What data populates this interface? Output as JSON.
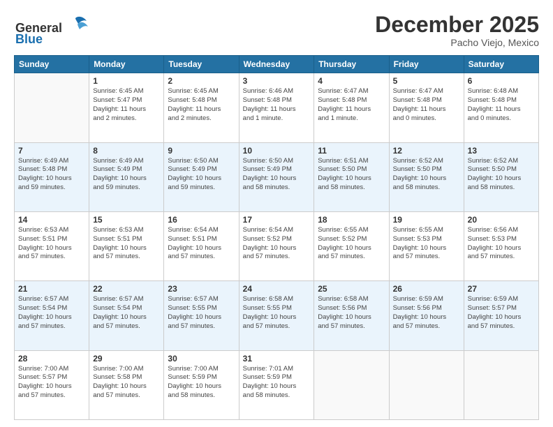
{
  "header": {
    "logo": {
      "text_general": "General",
      "text_blue": "Blue"
    },
    "title": "December 2025",
    "location": "Pacho Viejo, Mexico"
  },
  "calendar": {
    "columns": [
      "Sunday",
      "Monday",
      "Tuesday",
      "Wednesday",
      "Thursday",
      "Friday",
      "Saturday"
    ],
    "weeks": [
      {
        "days": [
          {
            "num": "",
            "info": ""
          },
          {
            "num": "1",
            "info": "Sunrise: 6:45 AM\nSunset: 5:47 PM\nDaylight: 11 hours\nand 2 minutes."
          },
          {
            "num": "2",
            "info": "Sunrise: 6:45 AM\nSunset: 5:48 PM\nDaylight: 11 hours\nand 2 minutes."
          },
          {
            "num": "3",
            "info": "Sunrise: 6:46 AM\nSunset: 5:48 PM\nDaylight: 11 hours\nand 1 minute."
          },
          {
            "num": "4",
            "info": "Sunrise: 6:47 AM\nSunset: 5:48 PM\nDaylight: 11 hours\nand 1 minute."
          },
          {
            "num": "5",
            "info": "Sunrise: 6:47 AM\nSunset: 5:48 PM\nDaylight: 11 hours\nand 0 minutes."
          },
          {
            "num": "6",
            "info": "Sunrise: 6:48 AM\nSunset: 5:48 PM\nDaylight: 11 hours\nand 0 minutes."
          }
        ]
      },
      {
        "days": [
          {
            "num": "7",
            "info": "Sunrise: 6:49 AM\nSunset: 5:48 PM\nDaylight: 10 hours\nand 59 minutes."
          },
          {
            "num": "8",
            "info": "Sunrise: 6:49 AM\nSunset: 5:49 PM\nDaylight: 10 hours\nand 59 minutes."
          },
          {
            "num": "9",
            "info": "Sunrise: 6:50 AM\nSunset: 5:49 PM\nDaylight: 10 hours\nand 59 minutes."
          },
          {
            "num": "10",
            "info": "Sunrise: 6:50 AM\nSunset: 5:49 PM\nDaylight: 10 hours\nand 58 minutes."
          },
          {
            "num": "11",
            "info": "Sunrise: 6:51 AM\nSunset: 5:50 PM\nDaylight: 10 hours\nand 58 minutes."
          },
          {
            "num": "12",
            "info": "Sunrise: 6:52 AM\nSunset: 5:50 PM\nDaylight: 10 hours\nand 58 minutes."
          },
          {
            "num": "13",
            "info": "Sunrise: 6:52 AM\nSunset: 5:50 PM\nDaylight: 10 hours\nand 58 minutes."
          }
        ]
      },
      {
        "days": [
          {
            "num": "14",
            "info": "Sunrise: 6:53 AM\nSunset: 5:51 PM\nDaylight: 10 hours\nand 57 minutes."
          },
          {
            "num": "15",
            "info": "Sunrise: 6:53 AM\nSunset: 5:51 PM\nDaylight: 10 hours\nand 57 minutes."
          },
          {
            "num": "16",
            "info": "Sunrise: 6:54 AM\nSunset: 5:51 PM\nDaylight: 10 hours\nand 57 minutes."
          },
          {
            "num": "17",
            "info": "Sunrise: 6:54 AM\nSunset: 5:52 PM\nDaylight: 10 hours\nand 57 minutes."
          },
          {
            "num": "18",
            "info": "Sunrise: 6:55 AM\nSunset: 5:52 PM\nDaylight: 10 hours\nand 57 minutes."
          },
          {
            "num": "19",
            "info": "Sunrise: 6:55 AM\nSunset: 5:53 PM\nDaylight: 10 hours\nand 57 minutes."
          },
          {
            "num": "20",
            "info": "Sunrise: 6:56 AM\nSunset: 5:53 PM\nDaylight: 10 hours\nand 57 minutes."
          }
        ]
      },
      {
        "days": [
          {
            "num": "21",
            "info": "Sunrise: 6:57 AM\nSunset: 5:54 PM\nDaylight: 10 hours\nand 57 minutes."
          },
          {
            "num": "22",
            "info": "Sunrise: 6:57 AM\nSunset: 5:54 PM\nDaylight: 10 hours\nand 57 minutes."
          },
          {
            "num": "23",
            "info": "Sunrise: 6:57 AM\nSunset: 5:55 PM\nDaylight: 10 hours\nand 57 minutes."
          },
          {
            "num": "24",
            "info": "Sunrise: 6:58 AM\nSunset: 5:55 PM\nDaylight: 10 hours\nand 57 minutes."
          },
          {
            "num": "25",
            "info": "Sunrise: 6:58 AM\nSunset: 5:56 PM\nDaylight: 10 hours\nand 57 minutes."
          },
          {
            "num": "26",
            "info": "Sunrise: 6:59 AM\nSunset: 5:56 PM\nDaylight: 10 hours\nand 57 minutes."
          },
          {
            "num": "27",
            "info": "Sunrise: 6:59 AM\nSunset: 5:57 PM\nDaylight: 10 hours\nand 57 minutes."
          }
        ]
      },
      {
        "days": [
          {
            "num": "28",
            "info": "Sunrise: 7:00 AM\nSunset: 5:57 PM\nDaylight: 10 hours\nand 57 minutes."
          },
          {
            "num": "29",
            "info": "Sunrise: 7:00 AM\nSunset: 5:58 PM\nDaylight: 10 hours\nand 57 minutes."
          },
          {
            "num": "30",
            "info": "Sunrise: 7:00 AM\nSunset: 5:59 PM\nDaylight: 10 hours\nand 58 minutes."
          },
          {
            "num": "31",
            "info": "Sunrise: 7:01 AM\nSunset: 5:59 PM\nDaylight: 10 hours\nand 58 minutes."
          },
          {
            "num": "",
            "info": ""
          },
          {
            "num": "",
            "info": ""
          },
          {
            "num": "",
            "info": ""
          }
        ]
      }
    ]
  }
}
